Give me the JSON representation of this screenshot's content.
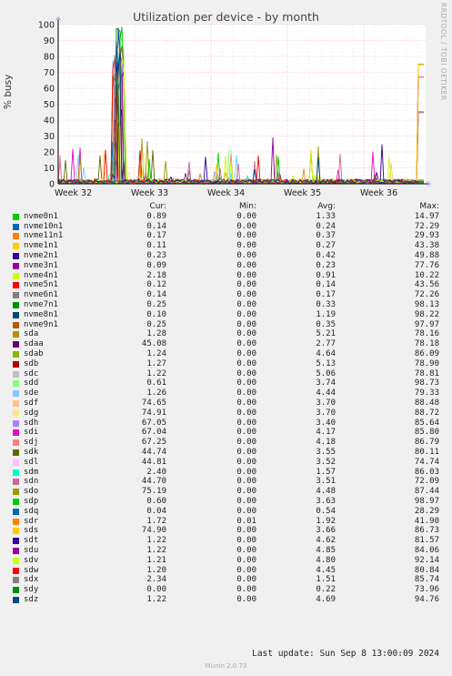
{
  "chart_data": {
    "type": "line",
    "title": "Utilization per device - by month",
    "ylabel": "% busy",
    "ylim": [
      0,
      100
    ],
    "yticks": [
      0,
      10,
      20,
      30,
      40,
      50,
      60,
      70,
      80,
      90,
      100
    ],
    "xticks": [
      "Week 32",
      "Week 33",
      "Week 34",
      "Week 35",
      "Week 36"
    ],
    "grid": true,
    "series": [
      {
        "name": "nvme0n1",
        "color": "#00cc00",
        "cur": "0.89",
        "min": "0.00",
        "avg": "1.33",
        "max": "14.97"
      },
      {
        "name": "nvme10n1",
        "color": "#0066b3",
        "cur": "0.14",
        "min": "0.00",
        "avg": "0.24",
        "max": "72.29"
      },
      {
        "name": "nvme11n1",
        "color": "#ff8000",
        "cur": "0.17",
        "min": "0.00",
        "avg": "0.37",
        "max": "29.93"
      },
      {
        "name": "nvme1n1",
        "color": "#ffcc00",
        "cur": "0.11",
        "min": "0.00",
        "avg": "0.27",
        "max": "43.38"
      },
      {
        "name": "nvme2n1",
        "color": "#330099",
        "cur": "0.23",
        "min": "0.00",
        "avg": "0.42",
        "max": "49.88"
      },
      {
        "name": "nvme3n1",
        "color": "#990099",
        "cur": "0.09",
        "min": "0.00",
        "avg": "0.23",
        "max": "77.76"
      },
      {
        "name": "nvme4n1",
        "color": "#ccff00",
        "cur": "2.18",
        "min": "0.00",
        "avg": "0.91",
        "max": "10.22"
      },
      {
        "name": "nvme5n1",
        "color": "#ff0000",
        "cur": "0.12",
        "min": "0.00",
        "avg": "0.14",
        "max": "43.56"
      },
      {
        "name": "nvme6n1",
        "color": "#808080",
        "cur": "0.14",
        "min": "0.00",
        "avg": "0.17",
        "max": "72.26"
      },
      {
        "name": "nvme7n1",
        "color": "#008f00",
        "cur": "0.25",
        "min": "0.00",
        "avg": "0.33",
        "max": "98.13"
      },
      {
        "name": "nvme8n1",
        "color": "#00487d",
        "cur": "0.10",
        "min": "0.00",
        "avg": "1.19",
        "max": "98.22"
      },
      {
        "name": "nvme9n1",
        "color": "#b35a00",
        "cur": "0.25",
        "min": "0.00",
        "avg": "0.35",
        "max": "97.97"
      },
      {
        "name": "sda",
        "color": "#b38f00",
        "cur": "1.28",
        "min": "0.00",
        "avg": "5.21",
        "max": "78.16"
      },
      {
        "name": "sdaa",
        "color": "#6b006b",
        "cur": "45.08",
        "min": "0.00",
        "avg": "2.77",
        "max": "78.18"
      },
      {
        "name": "sdab",
        "color": "#8fb300",
        "cur": "1.24",
        "min": "0.00",
        "avg": "4.64",
        "max": "86.09"
      },
      {
        "name": "sdb",
        "color": "#b30000",
        "cur": "1.27",
        "min": "0.00",
        "avg": "5.13",
        "max": "78.90"
      },
      {
        "name": "sdc",
        "color": "#bebebe",
        "cur": "1.22",
        "min": "0.00",
        "avg": "5.06",
        "max": "78.81"
      },
      {
        "name": "sdd",
        "color": "#80ff80",
        "cur": "0.61",
        "min": "0.00",
        "avg": "3.74",
        "max": "98.73"
      },
      {
        "name": "sde",
        "color": "#80c9ff",
        "cur": "1.26",
        "min": "0.00",
        "avg": "4.44",
        "max": "79.33"
      },
      {
        "name": "sdf",
        "color": "#ffc080",
        "cur": "74.65",
        "min": "0.00",
        "avg": "3.70",
        "max": "88.48"
      },
      {
        "name": "sdg",
        "color": "#ffe680",
        "cur": "74.91",
        "min": "0.00",
        "avg": "3.70",
        "max": "88.72"
      },
      {
        "name": "sdh",
        "color": "#aa80ff",
        "cur": "67.05",
        "min": "0.00",
        "avg": "3.40",
        "max": "85.64"
      },
      {
        "name": "sdi",
        "color": "#ee00cc",
        "cur": "67.04",
        "min": "0.00",
        "avg": "4.17",
        "max": "85.80"
      },
      {
        "name": "sdj",
        "color": "#ff8080",
        "cur": "67.25",
        "min": "0.00",
        "avg": "4.18",
        "max": "86.79"
      },
      {
        "name": "sdk",
        "color": "#666600",
        "cur": "44.74",
        "min": "0.00",
        "avg": "3.55",
        "max": "80.11"
      },
      {
        "name": "sdl",
        "color": "#ffbfff",
        "cur": "44.81",
        "min": "0.00",
        "avg": "3.52",
        "max": "74.74"
      },
      {
        "name": "sdm",
        "color": "#00ffcc",
        "cur": "2.40",
        "min": "0.00",
        "avg": "1.57",
        "max": "86.03"
      },
      {
        "name": "sdn",
        "color": "#cc6699",
        "cur": "44.70",
        "min": "0.00",
        "avg": "3.51",
        "max": "72.09"
      },
      {
        "name": "sdo",
        "color": "#999900",
        "cur": "75.19",
        "min": "0.00",
        "avg": "4.48",
        "max": "87.44"
      },
      {
        "name": "sdp",
        "color": "#00cc00",
        "cur": "0.60",
        "min": "0.00",
        "avg": "3.63",
        "max": "98.97"
      },
      {
        "name": "sdq",
        "color": "#0066b3",
        "cur": "0.04",
        "min": "0.00",
        "avg": "0.54",
        "max": "28.29"
      },
      {
        "name": "sdr",
        "color": "#ff8000",
        "cur": "1.72",
        "min": "0.01",
        "avg": "1.92",
        "max": "41.90"
      },
      {
        "name": "sds",
        "color": "#ffcc00",
        "cur": "74.90",
        "min": "0.00",
        "avg": "3.66",
        "max": "86.73"
      },
      {
        "name": "sdt",
        "color": "#330099",
        "cur": "1.22",
        "min": "0.00",
        "avg": "4.62",
        "max": "81.57"
      },
      {
        "name": "sdu",
        "color": "#990099",
        "cur": "1.22",
        "min": "0.00",
        "avg": "4.85",
        "max": "84.06"
      },
      {
        "name": "sdv",
        "color": "#ccff00",
        "cur": "1.21",
        "min": "0.00",
        "avg": "4.80",
        "max": "92.14"
      },
      {
        "name": "sdw",
        "color": "#ff0000",
        "cur": "1.20",
        "min": "0.00",
        "avg": "4.45",
        "max": "80.84"
      },
      {
        "name": "sdx",
        "color": "#808080",
        "cur": "2.34",
        "min": "0.00",
        "avg": "1.51",
        "max": "85.74"
      },
      {
        "name": "sdy",
        "color": "#008f00",
        "cur": "0.00",
        "min": "0.00",
        "avg": "0.22",
        "max": "73.96"
      },
      {
        "name": "sdz",
        "color": "#00487d",
        "cur": "1.22",
        "min": "0.00",
        "avg": "4.69",
        "max": "94.76"
      }
    ]
  },
  "legend_headers": {
    "cur": "Cur:",
    "min": "Min:",
    "avg": "Avg:",
    "max": "Max:"
  },
  "footer": {
    "last_update": "Last update: Sun Sep  8 13:00:09 2024",
    "generator": "Munin 2.0.73",
    "vertical_tag": "RRDTOOL / TOBI OETIKER"
  }
}
